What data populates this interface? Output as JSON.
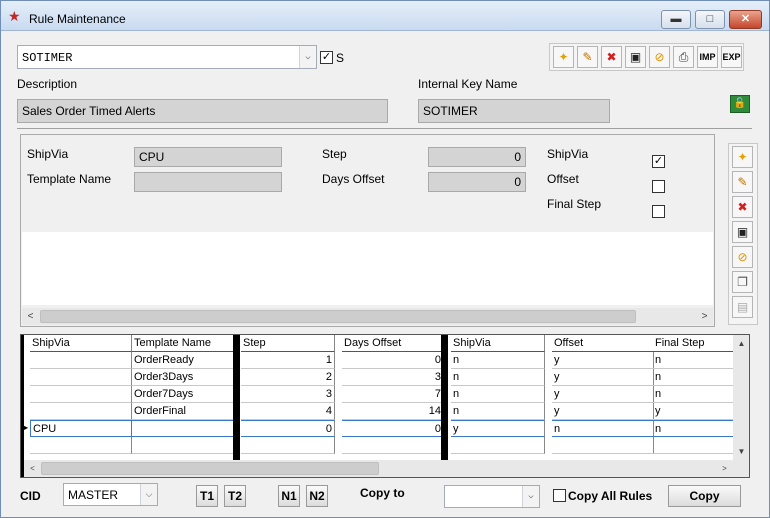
{
  "window": {
    "title": "Rule Maintenance",
    "min": "▬",
    "max": "□",
    "close": "✕"
  },
  "header": {
    "rule_select": "SOTIMER",
    "s_checked": "✓",
    "s_label": "S",
    "description_label": "Description",
    "description_value": "Sales Order Timed Alerts",
    "key_label": "Internal Key Name",
    "key_value": "SOTIMER"
  },
  "toolbar": [
    {
      "name": "new-icon",
      "glyph": "✦",
      "color": "#e8a000"
    },
    {
      "name": "edit-icon",
      "glyph": "✎",
      "color": "#c07000"
    },
    {
      "name": "delete-icon",
      "glyph": "✖",
      "color": "#d02020"
    },
    {
      "name": "save-icon",
      "glyph": "▣",
      "color": "#222"
    },
    {
      "name": "cancel-icon",
      "glyph": "⊘",
      "color": "#e09000"
    },
    {
      "name": "print-icon",
      "glyph": "⎙",
      "color": "#333"
    },
    {
      "name": "import-icon",
      "glyph": "IMP",
      "color": "#000"
    },
    {
      "name": "export-icon",
      "glyph": "EXP",
      "color": "#000"
    }
  ],
  "side_toolbar": [
    {
      "name": "new-icon",
      "glyph": "✦",
      "color": "#e8a000"
    },
    {
      "name": "edit-icon",
      "glyph": "✎",
      "color": "#c07000"
    },
    {
      "name": "delete-icon",
      "glyph": "✖",
      "color": "#d02020"
    },
    {
      "name": "save-icon",
      "glyph": "▣",
      "color": "#222"
    },
    {
      "name": "cancel-icon",
      "glyph": "⊘",
      "color": "#e09000"
    },
    {
      "name": "copy-icon",
      "glyph": "❐",
      "color": "#555"
    },
    {
      "name": "paste-icon",
      "glyph": "▤",
      "color": "#aaa"
    }
  ],
  "detail": {
    "shipvia_label": "ShipVia",
    "shipvia_value": "CPU",
    "template_label": "Template Name",
    "template_value": "",
    "step_label": "Step",
    "step_value": "0",
    "days_label": "Days Offset",
    "days_value": "0",
    "shipvia_flag_label": "ShipVia",
    "shipvia_flag": "✓",
    "offset_label": "Offset",
    "offset_flag": "",
    "final_label": "Final Step",
    "final_flag": ""
  },
  "grid": {
    "columns": [
      "ShipVia",
      "Template Name",
      "Step",
      "Days Offset",
      "ShipVia",
      "Offset",
      "Final Step"
    ],
    "rows": [
      [
        "",
        "OrderReady",
        "1",
        "0",
        "n",
        "y",
        "n"
      ],
      [
        "",
        "Order3Days",
        "2",
        "3",
        "n",
        "y",
        "n"
      ],
      [
        "",
        "Order7Days",
        "3",
        "7",
        "n",
        "y",
        "n"
      ],
      [
        "",
        "OrderFinal",
        "4",
        "14",
        "n",
        "y",
        "y"
      ],
      [
        "CPU",
        "",
        "0",
        "0",
        "y",
        "n",
        "n"
      ]
    ]
  },
  "footer": {
    "cid_label": "CID",
    "cid_value": "MASTER",
    "t1": "T1",
    "t2": "T2",
    "n1": "N1",
    "n2": "N2",
    "copy_to_label": "Copy to",
    "copy_to_value": "",
    "copy_all_label": "Copy All Rules",
    "copy_button": "Copy"
  },
  "icons": {
    "dropdown": "⌵",
    "left": "<",
    "right": ">",
    "up": "▲",
    "down": "▼",
    "row_pointer": "▶",
    "lock": "🔓"
  }
}
